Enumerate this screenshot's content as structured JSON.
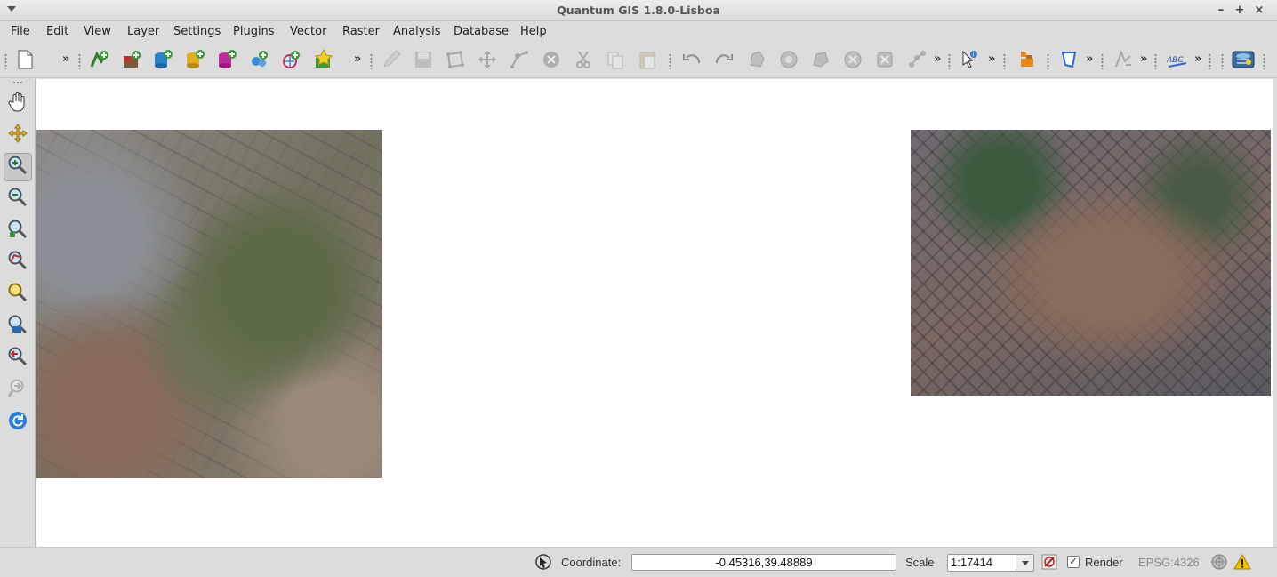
{
  "window": {
    "title": "Quantum GIS 1.8.0-Lisboa",
    "controls": {
      "minimize": "–",
      "maximize": "+",
      "close": "×"
    }
  },
  "menu": [
    "File",
    "Edit",
    "View",
    "Layer",
    "Settings",
    "Plugins",
    "Vector",
    "Raster",
    "Analysis",
    "Database",
    "Help"
  ],
  "toolbar": {
    "overflow_glyph": "»",
    "buttons": [
      "new-project-icon",
      "add-vector-layer-icon",
      "add-raster-layer-icon",
      "add-postgis-layer-icon",
      "add-spatialite-layer-icon",
      "add-mssql-layer-icon",
      "add-wms-layer-icon",
      "add-wfs-layer-icon",
      "new-shapefile-icon",
      "toggle-editing-icon",
      "save-edits-icon",
      "add-feature-icon",
      "move-feature-icon",
      "node-tool-icon",
      "delete-selected-icon",
      "cut-features-icon",
      "copy-features-icon",
      "paste-features-icon",
      "undo-icon",
      "redo-icon",
      "simplify-feature-icon",
      "add-ring-icon",
      "add-part-icon",
      "delete-ring-icon",
      "delete-part-icon",
      "reshape-features-icon",
      "identify-features-icon",
      "measure-line-icon",
      "annotation-icon",
      "gps-icon",
      "label-tool-icon",
      "coordinate-capture-icon"
    ]
  },
  "map_tools": [
    "pan-map-icon",
    "pan-to-selection-icon",
    "zoom-in-icon",
    "zoom-out-icon",
    "zoom-full-icon",
    "zoom-to-selection-icon",
    "zoom-to-layer-icon",
    "zoom-to-native-resolution-icon",
    "zoom-last-icon",
    "zoom-next-icon",
    "refresh-icon"
  ],
  "status": {
    "coordinate_label": "Coordinate:",
    "coordinate_value": "-0.45316,39.48889",
    "scale_label": "Scale",
    "scale_value": "1:17414",
    "render_label": "Render",
    "render_checked": true,
    "crs": "EPSG:4326"
  },
  "colors": {
    "accent": "#2a7fd4",
    "warning": "#f2c300"
  }
}
